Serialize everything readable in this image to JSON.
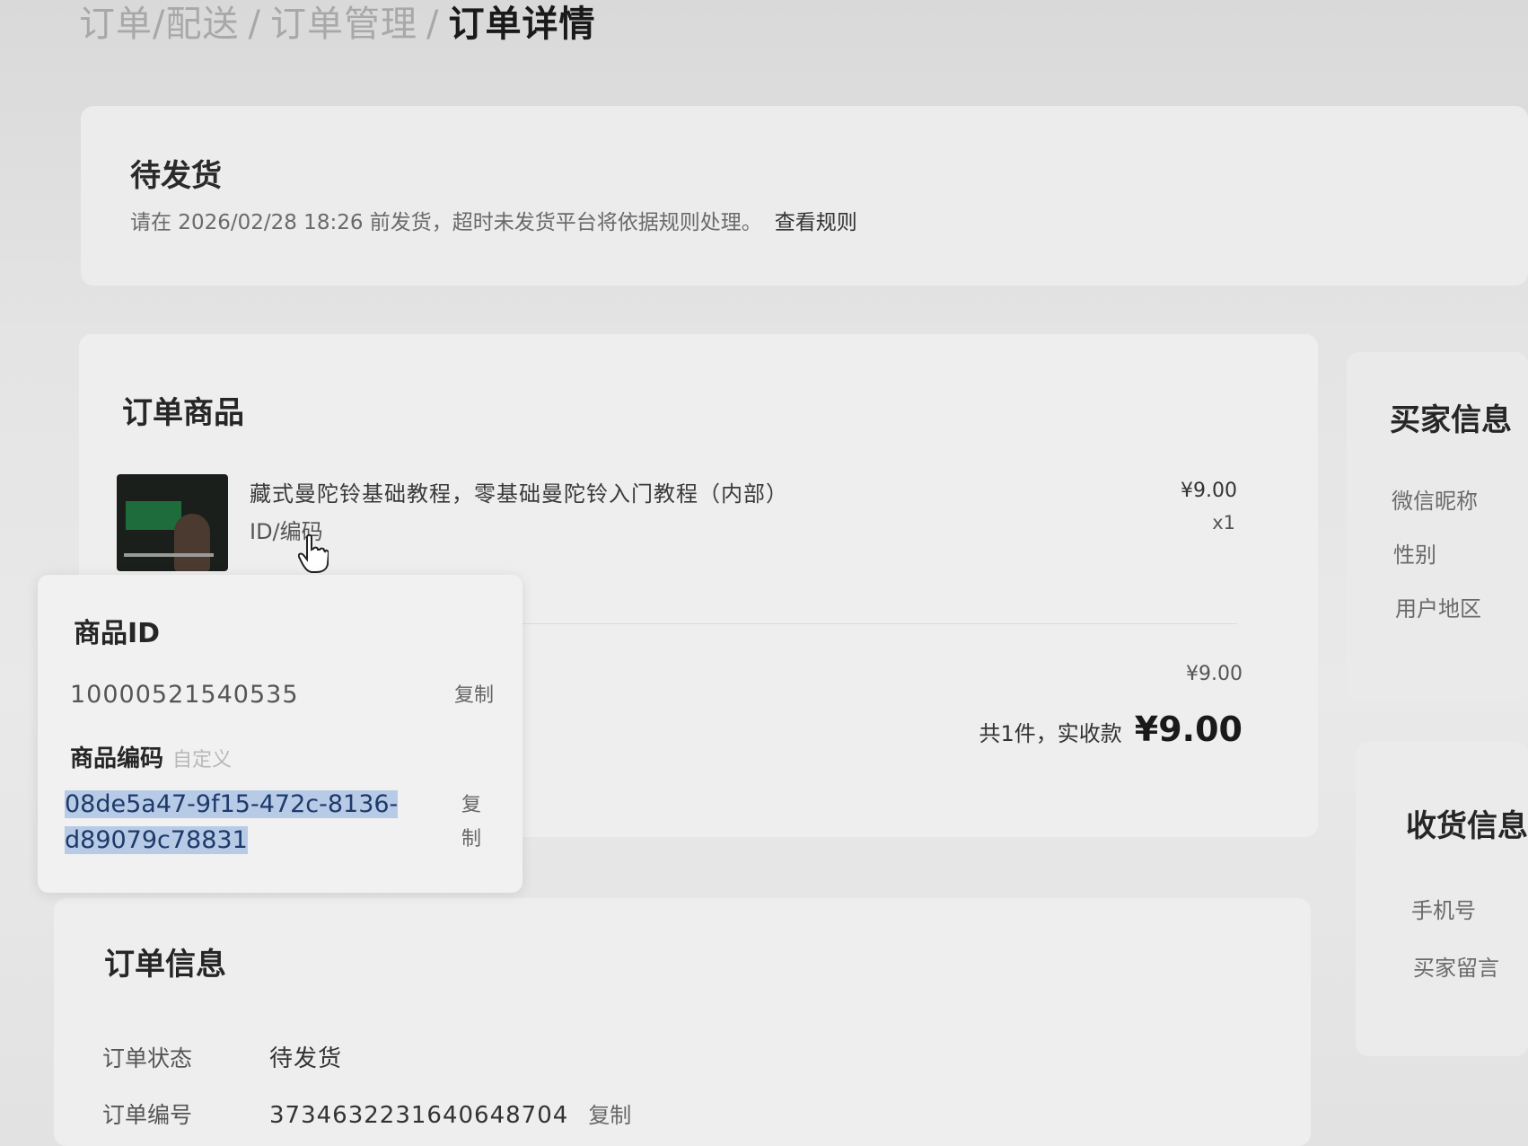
{
  "breadcrumb": [
    "订单/配送",
    "订单管理",
    "订单详情"
  ],
  "breadcrumb_sep": "/",
  "status": {
    "title": "待发货",
    "desc": "请在 2026/02/28 18:26 前发货，超时未发货平台将依据规则处理。",
    "link": "查看规则"
  },
  "goods": {
    "section_title": "订单商品",
    "name": "藏式曼陀铃基础教程，零基础曼陀铃入门教程（内部）",
    "id_link": "ID/编码",
    "price": "¥9.00",
    "qty": "x1",
    "subtotal": "¥9.00",
    "total_label": "共1件，实收款",
    "total_amount": "¥9.00",
    "thumb_icon": "course-thumbnail"
  },
  "popover": {
    "id_title": "商品ID",
    "id_value": "10000521540535",
    "copy_label": "复制",
    "code_title": "商品编码",
    "code_tag": "自定义",
    "code_value": "08de5a47-9f15-472c-8136-d89079c78831",
    "copy_label_2": "复制"
  },
  "order_info": {
    "title": "订单信息",
    "status_label": "订单状态",
    "status_value": "待发货",
    "number_label": "订单编号",
    "number_value": "3734632231640648704",
    "copy_label": "复制"
  },
  "buyer": {
    "title": "买家信息",
    "items": [
      "微信昵称",
      "性别",
      "用户地区"
    ]
  },
  "receiver": {
    "title": "收货信息",
    "items": [
      "手机号",
      "买家留言"
    ]
  },
  "colors": {
    "highlight": "#b8cbe6",
    "thumb_green": "#1e6b3c"
  }
}
